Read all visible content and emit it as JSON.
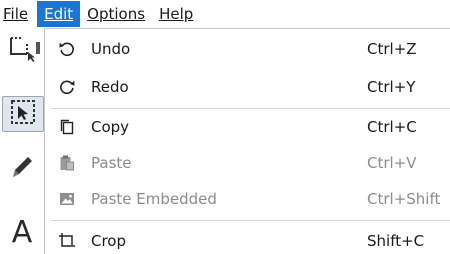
{
  "menubar": {
    "file_label": "File",
    "edit_label": "Edit",
    "options_label": "Options",
    "help_label": "Help"
  },
  "edit_menu": {
    "items": [
      {
        "label": "Undo",
        "shortcut": "Ctrl+Z",
        "icon": "undo-icon",
        "enabled": true
      },
      {
        "label": "Redo",
        "shortcut": "Ctrl+Y",
        "icon": "redo-icon",
        "enabled": true
      },
      {
        "label": "Copy",
        "shortcut": "Ctrl+C",
        "icon": "copy-icon",
        "enabled": true
      },
      {
        "label": "Paste",
        "shortcut": "Ctrl+V",
        "icon": "paste-icon",
        "enabled": false
      },
      {
        "label": "Paste Embedded",
        "shortcut": "Ctrl+Shift",
        "icon": "image-icon",
        "enabled": false
      },
      {
        "label": "Crop",
        "shortcut": "Shift+C",
        "icon": "crop-icon",
        "enabled": true
      }
    ]
  },
  "toolbar": {
    "tools": [
      "crop-tool-icon",
      "select-tool-icon",
      "pen-tool-icon",
      "text-tool-icon"
    ],
    "selected_tool": "select-tool-icon",
    "text_tool_glyph": "A"
  },
  "colors": {
    "menu_active_bg": "#1976d2",
    "disabled_text": "#8c8c8c",
    "selected_tool_bg": "#dfe6ef"
  }
}
